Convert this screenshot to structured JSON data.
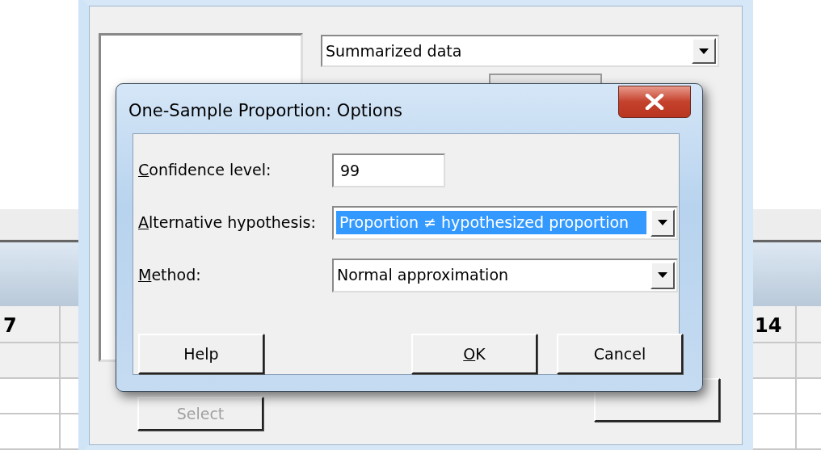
{
  "worksheet": {
    "column_headers": [
      "7",
      "14"
    ]
  },
  "parent_dialog": {
    "data_source": {
      "value": "Summarized data"
    },
    "select_button": {
      "label": "Select",
      "disabled": true
    }
  },
  "options_dialog": {
    "title": "One-Sample Proportion: Options",
    "fields": [
      {
        "kind": "text",
        "label": "Confidence level:",
        "mnemonic": true,
        "value": "99"
      },
      {
        "kind": "dropdown",
        "label": "Alternative hypothesis:",
        "mnemonic": true,
        "value": "Proportion ≠ hypothesized proportion",
        "highlighted": true
      },
      {
        "kind": "dropdown",
        "label": "Method:",
        "mnemonic": true,
        "value": "Normal approximation",
        "highlighted": false
      }
    ],
    "buttons": [
      {
        "label": "Help",
        "mnemonic": false
      },
      {
        "label": "OK",
        "mnemonic": true
      },
      {
        "label": "Cancel",
        "mnemonic": false
      }
    ]
  }
}
